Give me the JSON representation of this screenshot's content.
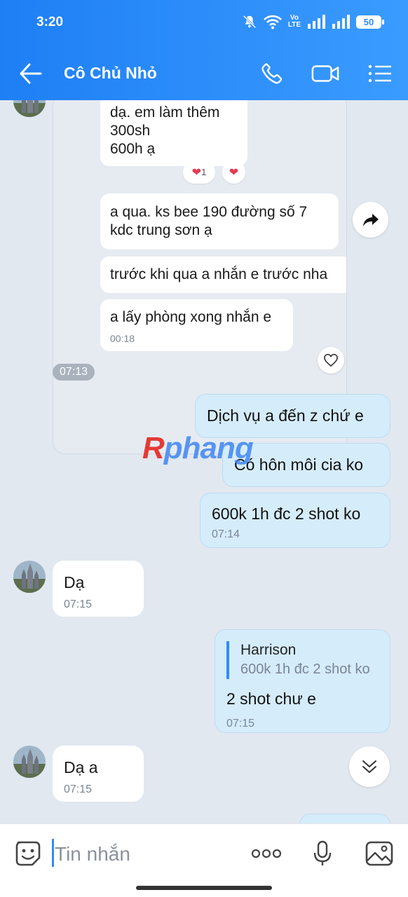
{
  "status_bar": {
    "time": "3:20",
    "volte_top": "Vo",
    "volte_bottom": "LTE",
    "battery": "50"
  },
  "header": {
    "title": "Cô Chủ Nhỏ"
  },
  "forwarded": {
    "msg1_lines": [
      "dạ. em làm thêm",
      "300sh",
      "600h ạ"
    ],
    "reaction1_count": "1",
    "msg2_lines": [
      "a qua. ks bee 190 đường số 7",
      "kdc trung sơn ạ"
    ],
    "msg3": "trước khi qua a nhắn e trước nha",
    "msg4": "a lấy phòng xong nhắn e",
    "msg4_time": "00:18"
  },
  "divider_time": "07:13",
  "outgoing": [
    {
      "text": "Dịch vụ a đến z chứ e"
    },
    {
      "text": "Có hôn môi cia ko"
    },
    {
      "text": "600k 1h đc 2 shot ko",
      "time": "07:14"
    }
  ],
  "incoming1": {
    "text": "Dạ",
    "time": "07:15"
  },
  "reply": {
    "quote_name": "Harrison",
    "quote_text": "600k 1h đc 2 shot ko",
    "text": "2 shot chư e",
    "time": "07:15"
  },
  "incoming2": {
    "text": "Dạ a",
    "time": "07:15"
  },
  "watermark": {
    "first": "R",
    "rest": "phang"
  },
  "input": {
    "placeholder": "Tin nhắn"
  },
  "colors": {
    "accent": "#2d8cfb",
    "outgoing_bubble": "#d5ecfb",
    "chat_bg": "#e2e8f0"
  }
}
